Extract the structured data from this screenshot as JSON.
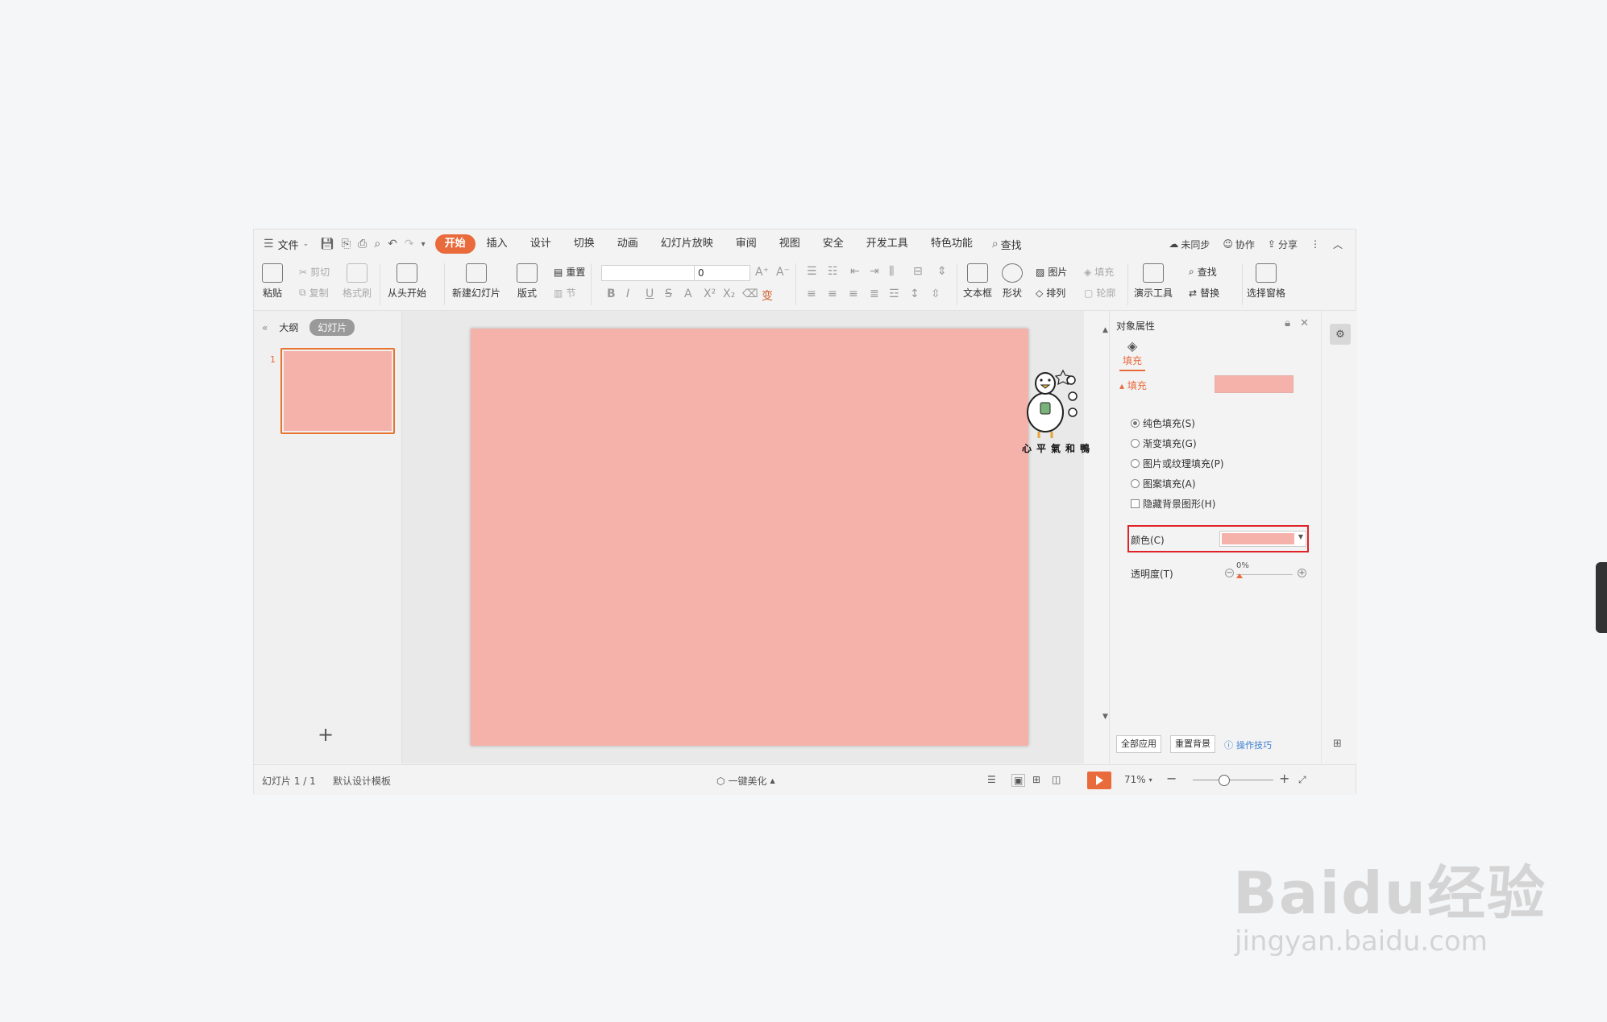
{
  "menubar": {
    "file_label": "文件",
    "tabs": [
      {
        "label": "开始",
        "active": true
      },
      {
        "label": "插入"
      },
      {
        "label": "设计"
      },
      {
        "label": "切换"
      },
      {
        "label": "动画"
      },
      {
        "label": "幻灯片放映"
      },
      {
        "label": "审阅"
      },
      {
        "label": "视图"
      },
      {
        "label": "安全"
      },
      {
        "label": "开发工具"
      },
      {
        "label": "特色功能"
      }
    ],
    "search_label": "查找",
    "sync_label": "未同步",
    "collab_label": "协作",
    "share_label": "分享"
  },
  "ribbon": {
    "paste": "粘贴",
    "cut": "剪切",
    "copy": "复制",
    "format_painter": "格式刷",
    "from_start": "从头开始",
    "new_slide": "新建幻灯片",
    "layout": "版式",
    "reset": "重置",
    "section": "节",
    "font_size": "0",
    "textbox": "文本框",
    "shape": "形状",
    "picture": "图片",
    "fill": "填充",
    "arrange": "排列",
    "outline": "轮廓",
    "present_tools": "演示工具",
    "find": "查找",
    "replace": "替换",
    "selection_pane": "选择窗格"
  },
  "left_panel": {
    "tab_outline": "大纲",
    "tab_slides": "幻灯片",
    "slide_number": "1"
  },
  "right_panel": {
    "title": "对象属性",
    "fill_tab": "填充",
    "section_fill": "填充",
    "options": [
      "纯色填充(S)",
      "渐变填充(G)",
      "图片或纹理填充(P)",
      "图案填充(A)"
    ],
    "hide_bg": "隐藏背景图形(H)",
    "color_label": "颜色(C)",
    "transparency_label": "透明度(T)",
    "transparency_value": "0%",
    "apply_all": "全部应用",
    "reset_bg": "重置背景",
    "tips": "操作技巧"
  },
  "sticker_text": "心平氣和鴨",
  "status": {
    "slide_info": "幻灯片 1 / 1",
    "template": "默认设计模板",
    "beautify": "一键美化",
    "zoom": "71%"
  },
  "watermark": {
    "brand": "Baidu经验",
    "url": "jingyan.baidu.com"
  },
  "colors": {
    "accent": "#e96a3b",
    "slide_fill": "#f5b2ab",
    "highlight": "#e0222a"
  }
}
